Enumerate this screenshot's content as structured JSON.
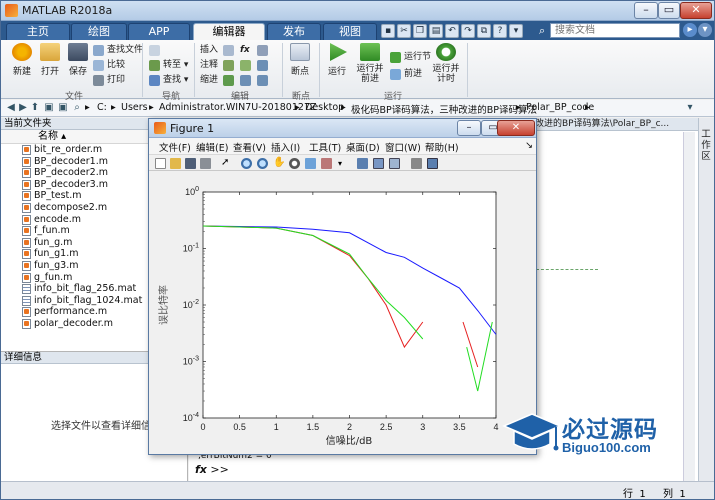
{
  "app": {
    "title": "MATLAB R2018a"
  },
  "tabs": [
    "主页",
    "绘图",
    "APP",
    "编辑器",
    "发布",
    "视图"
  ],
  "search": {
    "placeholder": "搜索文档"
  },
  "ribbon": {
    "file": {
      "new": "新建",
      "open": "打开",
      "save": "保存",
      "find_files": "查找文件",
      "compare": "比较",
      "print": "打印",
      "group": "文件"
    },
    "navigate": {
      "goto": "转至",
      "find": "查找",
      "group": "导航"
    },
    "edit": {
      "insert": "插入",
      "comment": "注释",
      "indent": "缩进",
      "fx": "fx",
      "group": "编辑"
    },
    "breakpoints": {
      "label": "断点",
      "group": "断点"
    },
    "run": {
      "run": "运行",
      "run_advance": "运行并前进",
      "run_section": "运行节",
      "advance": "前进",
      "run_time": "运行并计时",
      "group": "运行"
    }
  },
  "address": {
    "segments": [
      "C:",
      "Users",
      "Administrator.WIN7U-20180127Z",
      "Desktop",
      "极化码BP译码算法，三种改进的BP译码算法",
      "Polar_BP_code"
    ]
  },
  "folder_panel": {
    "title": "当前文件夹",
    "column": "名称",
    "files": [
      {
        "name": "bit_re_order.m",
        "type": "m"
      },
      {
        "name": "BP_decoder1.m",
        "type": "m"
      },
      {
        "name": "BP_decoder2.m",
        "type": "m"
      },
      {
        "name": "BP_decoder3.m",
        "type": "m"
      },
      {
        "name": "BP_test.m",
        "type": "m"
      },
      {
        "name": "decompose2.m",
        "type": "m"
      },
      {
        "name": "encode.m",
        "type": "m"
      },
      {
        "name": "f_fun.m",
        "type": "m"
      },
      {
        "name": "fun_g.m",
        "type": "m"
      },
      {
        "name": "fun_g1.m",
        "type": "m"
      },
      {
        "name": "fun_g3.m",
        "type": "m"
      },
      {
        "name": "g_fun.m",
        "type": "m"
      },
      {
        "name": "info_bit_flag_256.mat",
        "type": "mat"
      },
      {
        "name": "info_bit_flag_1024.mat",
        "type": "mat"
      },
      {
        "name": "performance.m",
        "type": "m"
      },
      {
        "name": "polar_decoder.m",
        "type": "m"
      }
    ]
  },
  "details_panel": {
    "title": "详细信息",
    "message": "选择文件以查看详细信息"
  },
  "editor": {
    "title": "改进的BP译码算法\\Polar_BP_c..."
  },
  "workspace": {
    "label": "工作区"
  },
  "command": {
    "line1": ",errBitNum2 = 0",
    "prompt": ">>",
    "fx": "fx"
  },
  "status": {
    "row_label": "行",
    "row_value": "1",
    "col_label": "列",
    "col_value": "1"
  },
  "figure": {
    "title": "Figure 1",
    "menus": [
      "文件(F)",
      "编辑(E)",
      "查看(V)",
      "插入(I)",
      "工具(T)",
      "桌面(D)",
      "窗口(W)",
      "帮助(H)"
    ]
  },
  "chart_data": {
    "type": "line",
    "title": "",
    "xlabel": "信噪比/dB",
    "ylabel": "误比特率",
    "yscale": "log",
    "xlim": [
      0,
      4
    ],
    "ylim": [
      0.0001,
      1
    ],
    "xticks": [
      "0",
      "0.5",
      "1",
      "1.5",
      "2",
      "2.5",
      "3",
      "3.5",
      "4"
    ],
    "yticks": [
      "10^0",
      "10^-1",
      "10^-2",
      "10^-3",
      "10^-4"
    ],
    "grid": false,
    "series": [
      {
        "color": "#1a1aff",
        "x": [
          0,
          0.5,
          1.0,
          1.5,
          2.0,
          2.5,
          2.75,
          3.0,
          3.25,
          3.5,
          3.75,
          4.0
        ],
        "y": [
          0.25,
          0.245,
          0.24,
          0.22,
          0.19,
          0.085,
          0.07,
          0.045,
          0.03,
          0.02,
          0.008,
          0.003
        ]
      },
      {
        "color": "#e62020",
        "segments": [
          {
            "x": [
              0,
              0.5,
              1.0,
              1.5,
              2.0,
              2.25,
              2.5,
              2.75,
              3.0
            ],
            "y": [
              0.25,
              0.24,
              0.23,
              0.17,
              0.075,
              0.03,
              0.01,
              0.0018,
              0.005
            ]
          },
          {
            "x": [
              3.55,
              3.75
            ],
            "y": [
              0.005,
              0.0008
            ]
          }
        ]
      },
      {
        "color": "#22dd22",
        "segments": [
          {
            "x": [
              0,
              0.5,
              1.0,
              1.5,
              2.0,
              2.25,
              2.5,
              2.75,
              3.0
            ],
            "y": [
              0.25,
              0.24,
              0.23,
              0.17,
              0.08,
              0.03,
              0.012,
              0.006,
              0.0025
            ]
          },
          {
            "x": [
              3.6,
              3.75,
              3.95
            ],
            "y": [
              0.0018,
              0.0003,
              0.005
            ]
          }
        ]
      }
    ]
  }
}
